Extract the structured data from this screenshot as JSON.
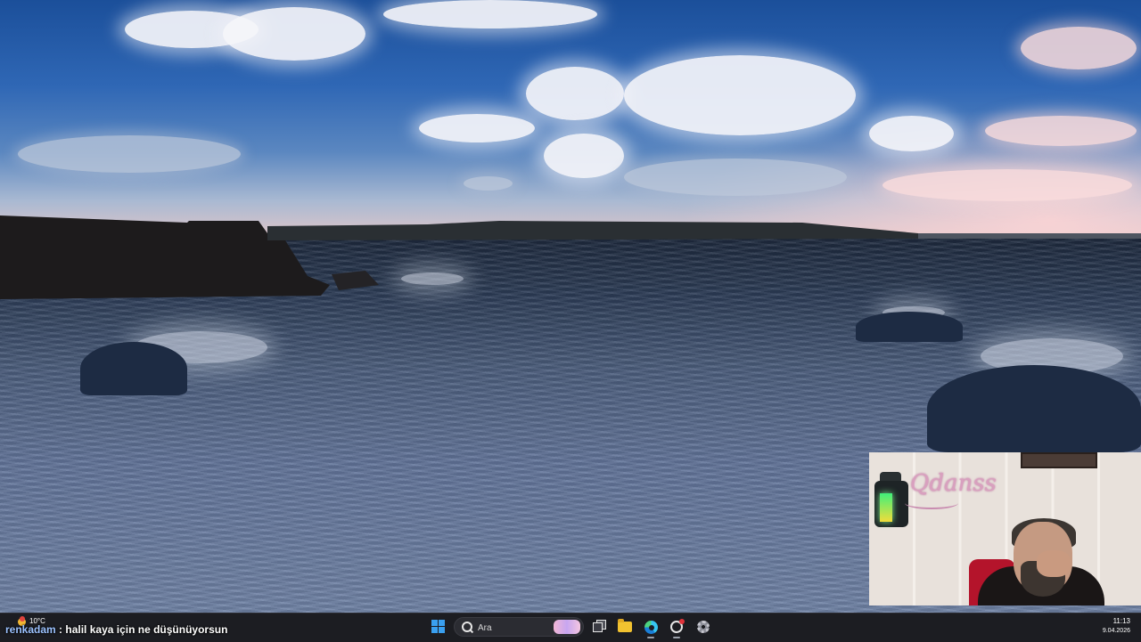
{
  "desktop": {
    "wallpaper": "stormy sea with cliffs and clouds"
  },
  "webcam": {
    "logo_text": "Qdanss"
  },
  "chat_overlay": {
    "username": "renkadam",
    "separator": " : ",
    "message": "halil kaya için ne düşünüyorsun"
  },
  "taskbar": {
    "weather": {
      "temperature": "10°C",
      "icon": "sun-icon"
    },
    "search": {
      "placeholder": "Ara"
    },
    "icons": [
      "windows-start-icon",
      "search-icon",
      "task-view-icon",
      "file-explorer-icon",
      "edge-browser-icon",
      "obs-icon",
      "settings-gear-icon"
    ],
    "clock": {
      "time": "11:13",
      "date": "9.04.2026"
    }
  },
  "colors": {
    "taskbar_bg": "#1c1d22",
    "accent": "#3aa0f0",
    "chat_username": "#9cc2ff"
  }
}
